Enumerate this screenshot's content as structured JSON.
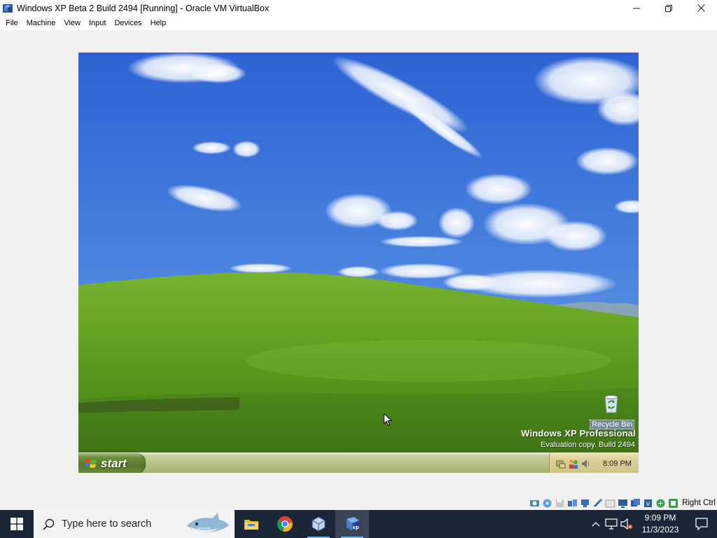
{
  "window": {
    "title": "Windows XP Beta 2 Build 2494 [Running] - Oracle VM VirtualBox",
    "controls": {
      "minimize": "—",
      "maximize": "❐",
      "close": "✕"
    }
  },
  "menu": [
    "File",
    "Machine",
    "View",
    "Input",
    "Devices",
    "Help"
  ],
  "guest": {
    "desktop_icons": [
      {
        "label": "Recycle Bin",
        "icon": "recycle-bin-icon"
      }
    ],
    "watermark": {
      "line1": "Windows XP Professional",
      "line2": "Evaluation copy. Build 2494"
    },
    "taskbar": {
      "start_label": "start",
      "tray_icons": [
        "network-icon",
        "people-icon",
        "volume-icon"
      ],
      "clock": "8:09 PM"
    }
  },
  "vbox_status": {
    "icons": [
      "hard-disk-icon",
      "optical-drive-icon",
      "floppy-icon",
      "audio-icon",
      "network-icon",
      "usb-icon",
      "shared-folders-icon",
      "display-icon",
      "video-capture-icon",
      "cpu-icon",
      "mouse-integration-icon",
      "keyboard-icon"
    ],
    "host_key": "Right Ctrl"
  },
  "host_taskbar": {
    "search_placeholder": "Type here to search",
    "apps": [
      {
        "name": "file-explorer-icon",
        "active": false
      },
      {
        "name": "chrome-icon",
        "active": false
      },
      {
        "name": "virtualbox-manager-icon",
        "active": false
      },
      {
        "name": "xp-vm-icon",
        "active": true
      }
    ],
    "time": "9:09 PM",
    "date": "11/3/2023"
  },
  "colors": {
    "vbox_chrome": "#ffffff",
    "xp_sky": "#3a6ed8",
    "xp_grass": "#5e9a1f",
    "xp_taskbar": "#b9c187",
    "win_taskbar": "#1b2736"
  }
}
